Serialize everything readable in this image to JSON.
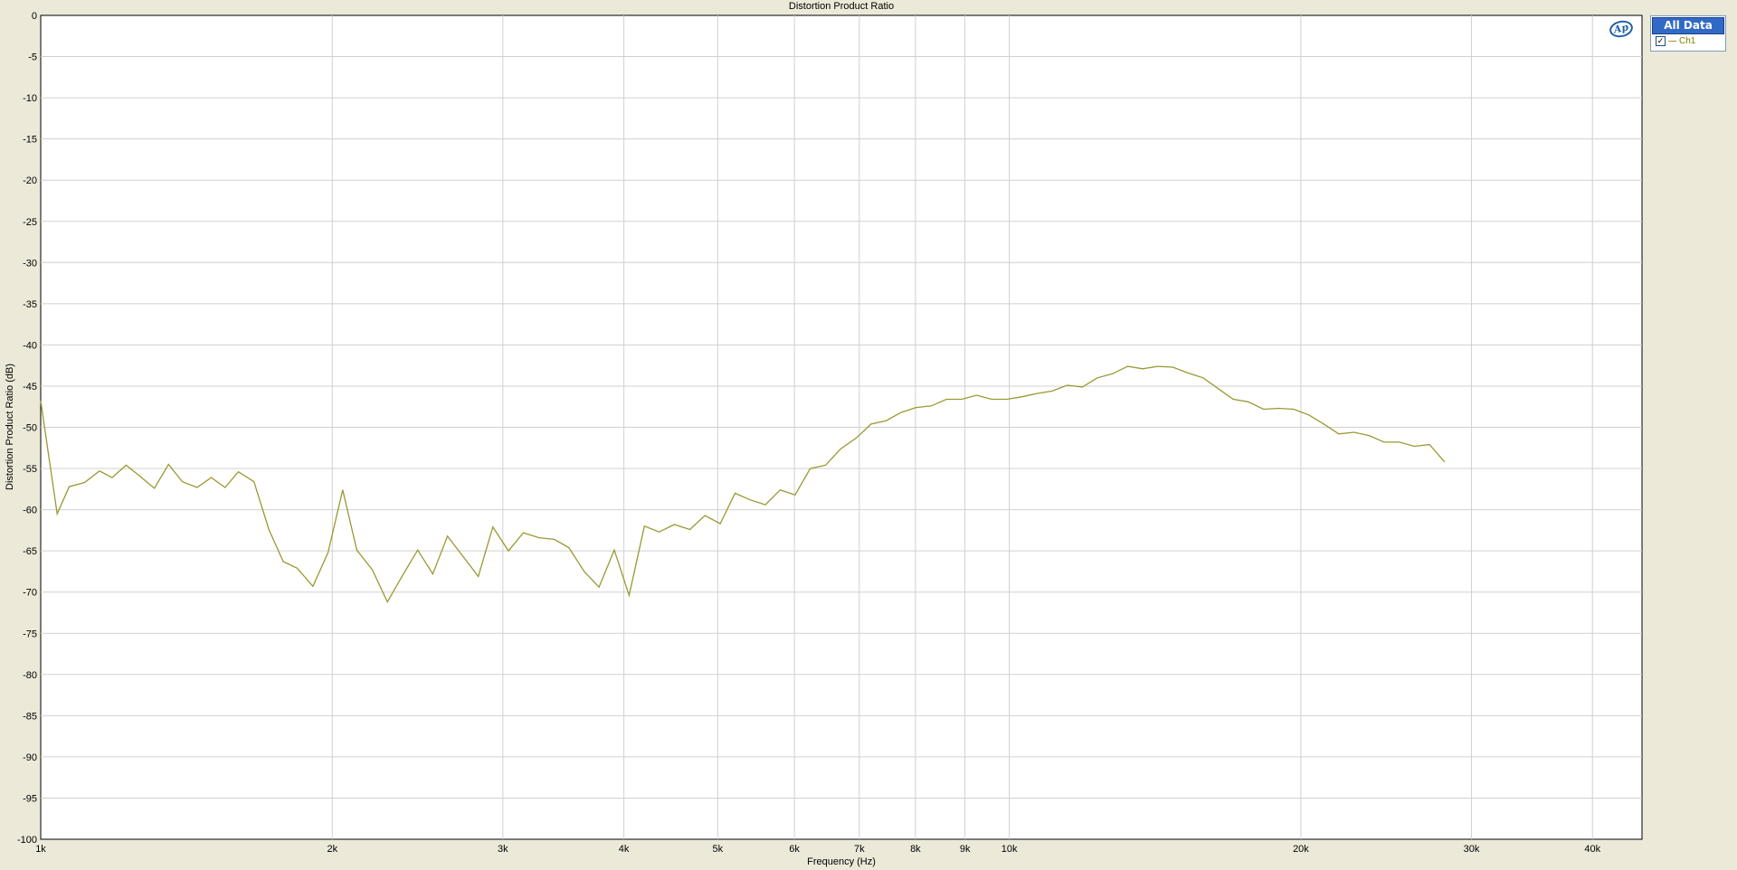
{
  "chart_data": {
    "type": "line",
    "title": "Distortion Product Ratio",
    "xlabel": "Frequency (Hz)",
    "ylabel": "Distortion Product Ratio (dB)",
    "x_scale": "log",
    "xlim": [
      1000,
      45000
    ],
    "ylim": [
      -100,
      0
    ],
    "grid": true,
    "x_ticks": [
      {
        "value": 1000,
        "label": "1k"
      },
      {
        "value": 2000,
        "label": "2k"
      },
      {
        "value": 3000,
        "label": "3k"
      },
      {
        "value": 4000,
        "label": "4k"
      },
      {
        "value": 5000,
        "label": "5k"
      },
      {
        "value": 6000,
        "label": "6k"
      },
      {
        "value": 7000,
        "label": "7k"
      },
      {
        "value": 8000,
        "label": "8k"
      },
      {
        "value": 9000,
        "label": "9k"
      },
      {
        "value": 10000,
        "label": "10k"
      },
      {
        "value": 20000,
        "label": "20k"
      },
      {
        "value": 30000,
        "label": "30k"
      },
      {
        "value": 40000,
        "label": "40k"
      }
    ],
    "y_ticks": [
      0,
      -5,
      -10,
      -15,
      -20,
      -25,
      -30,
      -35,
      -40,
      -45,
      -50,
      -55,
      -60,
      -65,
      -70,
      -75,
      -80,
      -85,
      -90,
      -95,
      -100
    ],
    "series": [
      {
        "name": "Ch1",
        "color": "#999933",
        "points": [
          [
            1000,
            -46.8
          ],
          [
            1040,
            -60.5
          ],
          [
            1070,
            -57.2
          ],
          [
            1110,
            -56.7
          ],
          [
            1150,
            -55.3
          ],
          [
            1185,
            -56.1
          ],
          [
            1225,
            -54.6
          ],
          [
            1265,
            -55.9
          ],
          [
            1310,
            -57.4
          ],
          [
            1355,
            -54.5
          ],
          [
            1400,
            -56.6
          ],
          [
            1450,
            -57.3
          ],
          [
            1500,
            -56.1
          ],
          [
            1550,
            -57.3
          ],
          [
            1600,
            -55.4
          ],
          [
            1660,
            -56.6
          ],
          [
            1720,
            -62.4
          ],
          [
            1780,
            -66.3
          ],
          [
            1840,
            -67.1
          ],
          [
            1910,
            -69.3
          ],
          [
            1980,
            -65.2
          ],
          [
            2050,
            -57.6
          ],
          [
            2120,
            -64.9
          ],
          [
            2200,
            -67.3
          ],
          [
            2280,
            -71.2
          ],
          [
            2360,
            -68.1
          ],
          [
            2450,
            -64.9
          ],
          [
            2540,
            -67.8
          ],
          [
            2630,
            -63.2
          ],
          [
            2730,
            -65.7
          ],
          [
            2830,
            -68.1
          ],
          [
            2930,
            -62.1
          ],
          [
            3040,
            -65.0
          ],
          [
            3150,
            -62.8
          ],
          [
            3270,
            -63.4
          ],
          [
            3390,
            -63.6
          ],
          [
            3510,
            -64.6
          ],
          [
            3640,
            -67.5
          ],
          [
            3770,
            -69.4
          ],
          [
            3910,
            -64.9
          ],
          [
            4050,
            -70.4
          ],
          [
            4200,
            -62.0
          ],
          [
            4350,
            -62.7
          ],
          [
            4510,
            -61.8
          ],
          [
            4680,
            -62.4
          ],
          [
            4850,
            -60.7
          ],
          [
            5030,
            -61.7
          ],
          [
            5210,
            -58.0
          ],
          [
            5400,
            -58.8
          ],
          [
            5600,
            -59.4
          ],
          [
            5800,
            -57.6
          ],
          [
            6010,
            -58.2
          ],
          [
            6230,
            -55.0
          ],
          [
            6460,
            -54.6
          ],
          [
            6700,
            -52.6
          ],
          [
            6950,
            -51.3
          ],
          [
            7200,
            -49.6
          ],
          [
            7460,
            -49.2
          ],
          [
            7730,
            -48.2
          ],
          [
            8010,
            -47.6
          ],
          [
            8310,
            -47.4
          ],
          [
            8610,
            -46.6
          ],
          [
            8930,
            -46.6
          ],
          [
            9250,
            -46.1
          ],
          [
            9590,
            -46.6
          ],
          [
            9940,
            -46.6
          ],
          [
            10300,
            -46.3
          ],
          [
            10680,
            -45.9
          ],
          [
            11070,
            -45.6
          ],
          [
            11480,
            -44.9
          ],
          [
            11900,
            -45.1
          ],
          [
            12330,
            -44.0
          ],
          [
            12780,
            -43.5
          ],
          [
            13250,
            -42.6
          ],
          [
            13730,
            -42.9
          ],
          [
            14230,
            -42.6
          ],
          [
            14750,
            -42.7
          ],
          [
            15290,
            -43.4
          ],
          [
            15850,
            -44.0
          ],
          [
            16430,
            -45.3
          ],
          [
            17030,
            -46.6
          ],
          [
            17650,
            -46.9
          ],
          [
            18300,
            -47.8
          ],
          [
            18970,
            -47.7
          ],
          [
            19660,
            -47.8
          ],
          [
            20380,
            -48.5
          ],
          [
            21120,
            -49.6
          ],
          [
            21890,
            -50.8
          ],
          [
            22690,
            -50.6
          ],
          [
            23520,
            -51.0
          ],
          [
            24380,
            -51.8
          ],
          [
            25270,
            -51.8
          ],
          [
            26190,
            -52.3
          ],
          [
            27150,
            -52.1
          ],
          [
            28150,
            -54.2
          ]
        ]
      }
    ],
    "legend": {
      "title": "All Data",
      "entries": [
        {
          "label": "Ch1",
          "checked": true
        }
      ]
    }
  }
}
